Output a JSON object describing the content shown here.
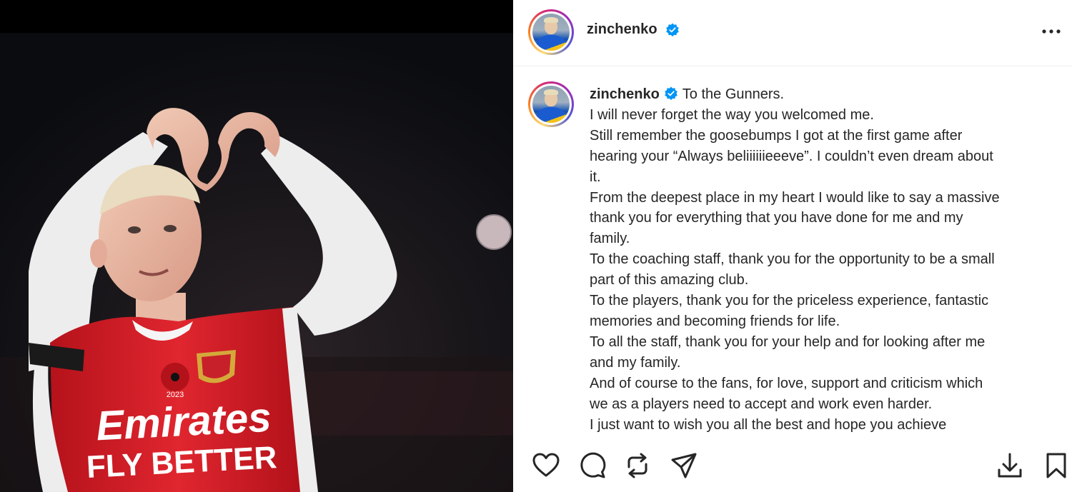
{
  "post": {
    "header": {
      "username": "zinchenko",
      "avatar_icon": "profile-avatar",
      "verified_icon": "verified-badge-icon",
      "more_icon": "more-options-icon"
    },
    "caption": {
      "username": "zinchenko",
      "lines": [
        "To the Gunners.",
        "I will never forget the way you welcomed me.",
        "Still remember the goosebumps I got at the first game after",
        "hearing your “Always beliiiiiieeeve”. I couldn’t even dream about",
        "it.",
        "From the deepest place in my heart I would like to say a massive",
        "thank you for everything that you have done for me and my",
        "family.",
        "To the coaching staff, thank you for the opportunity to be a small",
        "part of this amazing club.",
        "To the players, thank you for the priceless experience, fantastic",
        "memories and becoming friends for life.",
        "To all the staff, thank you for your help and for looking after me",
        "and my family.",
        "And of course to the fans, for love, support and criticism which",
        "we as a players need to accept and work even harder.",
        "I just want to wish you all the best and hope you achieve"
      ]
    },
    "actions": [
      "like-icon",
      "comment-icon",
      "repost-icon",
      "share-icon",
      "download-icon",
      "save-icon"
    ]
  },
  "photo": {
    "shirt_text_line1": "Emirates",
    "shirt_text_line2": "FLY BETTER",
    "poppy_text": "2023",
    "colors": {
      "shirt_red": "#d7262e",
      "sleeve_white": "#f2f2f2",
      "background": "#0a0c10"
    }
  },
  "colors": {
    "verified_blue": "#0095f6",
    "text": "#262626",
    "divider": "#efefef"
  }
}
